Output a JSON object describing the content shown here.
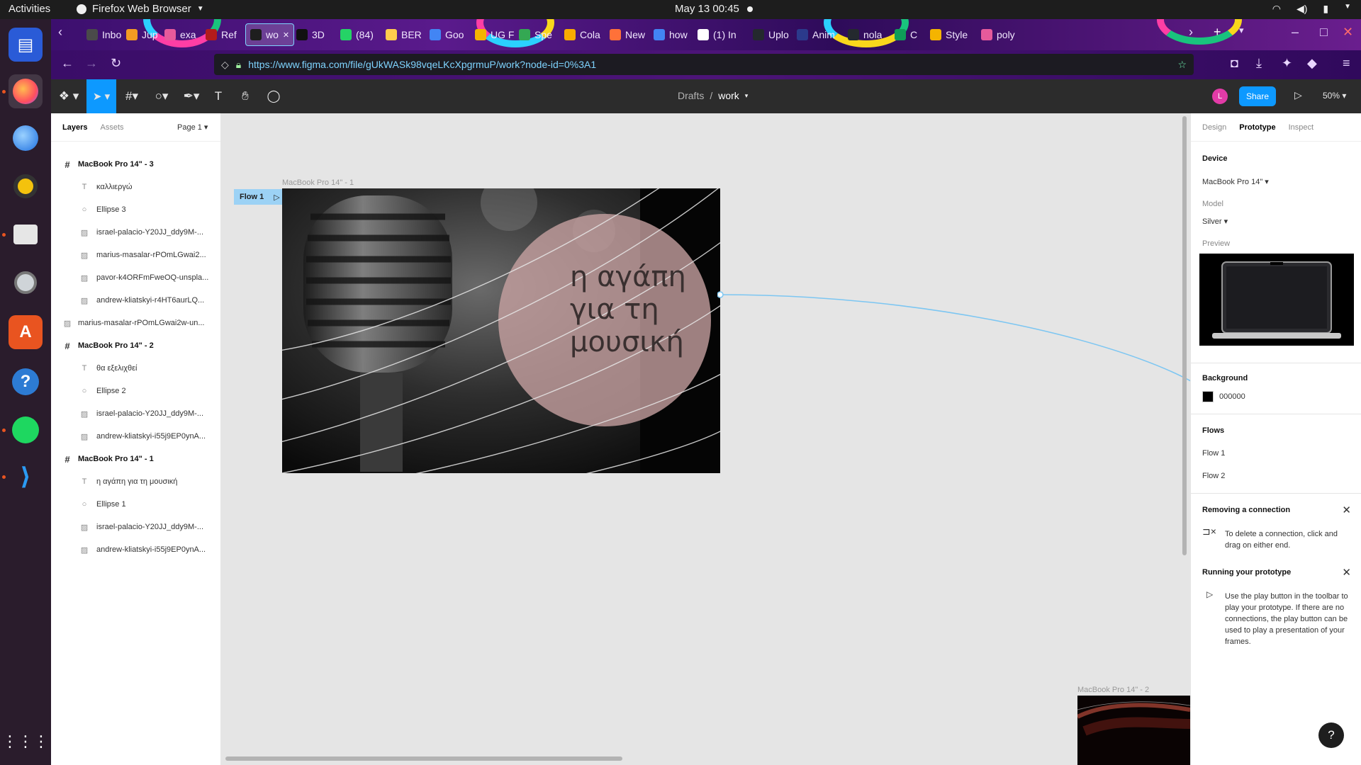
{
  "topbar": {
    "activities": "Activities",
    "app_name": "Firefox Web Browser",
    "clock": "May 13  00:45"
  },
  "browser": {
    "tabs": [
      {
        "label": "Inbo",
        "icon": "inbox-icon"
      },
      {
        "label": "Jup",
        "icon": "jupyter-icon"
      },
      {
        "label": "exa",
        "icon": "link-icon"
      },
      {
        "label": "Ref",
        "icon": "paper-icon"
      },
      {
        "label": "wo",
        "icon": "figma-icon",
        "active": true
      },
      {
        "label": "3D",
        "icon": "cube-icon"
      },
      {
        "label": "(84)",
        "icon": "whatsapp-icon"
      },
      {
        "label": "BER",
        "icon": "emoji-icon"
      },
      {
        "label": "Goo",
        "icon": "google-icon"
      },
      {
        "label": "UG F",
        "icon": "doc-icon"
      },
      {
        "label": "Spe",
        "icon": "globe-icon"
      },
      {
        "label": "Cola",
        "icon": "colab-icon"
      },
      {
        "label": "New",
        "icon": "firefox-icon"
      },
      {
        "label": "how",
        "icon": "google-g-icon"
      },
      {
        "label": "(1) In",
        "icon": "notion-icon"
      },
      {
        "label": "Uplo",
        "icon": "github-icon"
      },
      {
        "label": "Anim",
        "icon": "ids-icon"
      },
      {
        "label": "nola",
        "icon": "github-icon"
      },
      {
        "label": "C",
        "icon": "drive-icon"
      },
      {
        "label": "Style",
        "icon": "doc-icon"
      },
      {
        "label": "poly",
        "icon": "link-icon"
      }
    ],
    "url": "https://www.figma.com/file/gUkWASk98vqeLKcXpgrmuP/work?node-id=0%3A1"
  },
  "figma": {
    "breadcrumb": {
      "folder": "Drafts",
      "separator": "/",
      "file": "work"
    },
    "avatar_letter": "L",
    "share_label": "Share",
    "zoom": "50%",
    "left_panel": {
      "tab_layers": "Layers",
      "tab_assets": "Assets",
      "page": "Page 1"
    },
    "layers": [
      {
        "type": "frame",
        "name": "MacBook Pro 14\" - 3"
      },
      {
        "type": "text",
        "name": "καλλιεργώ"
      },
      {
        "type": "ellipse",
        "name": "Ellipse 3"
      },
      {
        "type": "image",
        "name": "israel-palacio-Y20JJ_ddy9M-..."
      },
      {
        "type": "image",
        "name": "marius-masalar-rPOmLGwai2..."
      },
      {
        "type": "image",
        "name": "pavor-k4ORFmFweOQ-unspla..."
      },
      {
        "type": "image",
        "name": "andrew-kliatskyi-r4HT6aurLQ..."
      },
      {
        "type": "image-top",
        "name": "marius-masalar-rPOmLGwai2w-un..."
      },
      {
        "type": "frame",
        "name": "MacBook Pro 14\" - 2"
      },
      {
        "type": "text",
        "name": "θα εξελιχθεί"
      },
      {
        "type": "ellipse",
        "name": "Ellipse 2"
      },
      {
        "type": "image",
        "name": "israel-palacio-Y20JJ_ddy9M-..."
      },
      {
        "type": "image",
        "name": "andrew-kliatskyi-i55j9EP0ynA..."
      },
      {
        "type": "frame",
        "name": "MacBook Pro 14\" - 1"
      },
      {
        "type": "text",
        "name": "η αγάπη για τη μουσική"
      },
      {
        "type": "ellipse",
        "name": "Ellipse 1"
      },
      {
        "type": "image",
        "name": "israel-palacio-Y20JJ_ddy9M-..."
      },
      {
        "type": "image",
        "name": "andrew-kliatskyi-i55j9EP0ynA..."
      }
    ],
    "canvas": {
      "frame1_label": "MacBook Pro 14\" - 1",
      "flow_chip": "Flow 1",
      "frame1_text_lines": [
        "η αγάπη",
        "για τη",
        "μουσική"
      ],
      "frame2_label": "MacBook Pro 14\" - 2"
    },
    "right_panel": {
      "tab_design": "Design",
      "tab_prototype": "Prototype",
      "tab_inspect": "Inspect",
      "device_heading": "Device",
      "device_value": "MacBook Pro 14\"",
      "model_label": "Model",
      "model_value": "Silver",
      "preview_label": "Preview",
      "background_heading": "Background",
      "background_hex": "000000",
      "flows_heading": "Flows",
      "flows": [
        "Flow 1",
        "Flow 2"
      ],
      "tip1_title": "Removing a connection",
      "tip1_text": "To delete a connection, click and drag on either end.",
      "tip2_title": "Running your prototype",
      "tip2_text": "Use the play button in the toolbar to play your prototype. If there are no connections, the play button can be used to play a presentation of your frames."
    },
    "help": "?"
  },
  "colors": {
    "figma_blue": "#0d99ff",
    "flow_chip": "#9cd2f5",
    "ellipse_fill": "#c9a3a3",
    "connector": "#7cc6f2"
  }
}
